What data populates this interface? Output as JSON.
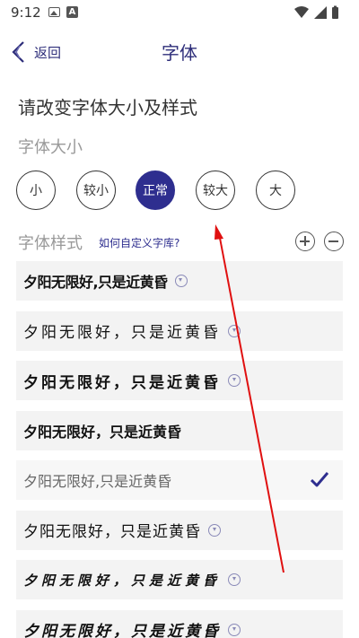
{
  "status_bar": {
    "time": "9:12",
    "a_icon_letter": "A",
    "icons": [
      "image-icon",
      "a-badge-icon",
      "wifi-icon",
      "signal-icon",
      "battery-icon"
    ]
  },
  "nav": {
    "back_label": "返回",
    "title": "字体"
  },
  "instruction": "请改变字体大小及样式",
  "size_section": {
    "heading": "字体大小",
    "options": [
      "小",
      "较小",
      "正常",
      "较大",
      "大"
    ],
    "selected": "正常"
  },
  "style_section": {
    "heading": "字体样式",
    "custom_link": "如何自定义字库?"
  },
  "fonts": [
    {
      "sample": "夕阳无限好,只是近黄昏",
      "downloadable": true,
      "selected": false
    },
    {
      "sample": "夕阳无限好，只是近黄昏",
      "downloadable": true,
      "selected": false
    },
    {
      "sample": "夕阳无限好，只是近黄昏",
      "downloadable": true,
      "selected": false
    },
    {
      "sample": "夕阳无限好，只是近黄昏",
      "downloadable": false,
      "selected": false
    },
    {
      "sample": "夕阳无限好,只是近黄昏",
      "downloadable": false,
      "selected": true
    },
    {
      "sample": "夕阳无限好，只是近黄昏",
      "downloadable": true,
      "selected": false
    },
    {
      "sample": "夕阳无限好，只是近黄昏",
      "downloadable": true,
      "selected": false
    },
    {
      "sample": "夕阳无限好，只是近黄昏",
      "downloadable": true,
      "selected": false
    }
  ],
  "colors": {
    "accent": "#2e2e8f",
    "annotation_arrow": "#e01010"
  }
}
